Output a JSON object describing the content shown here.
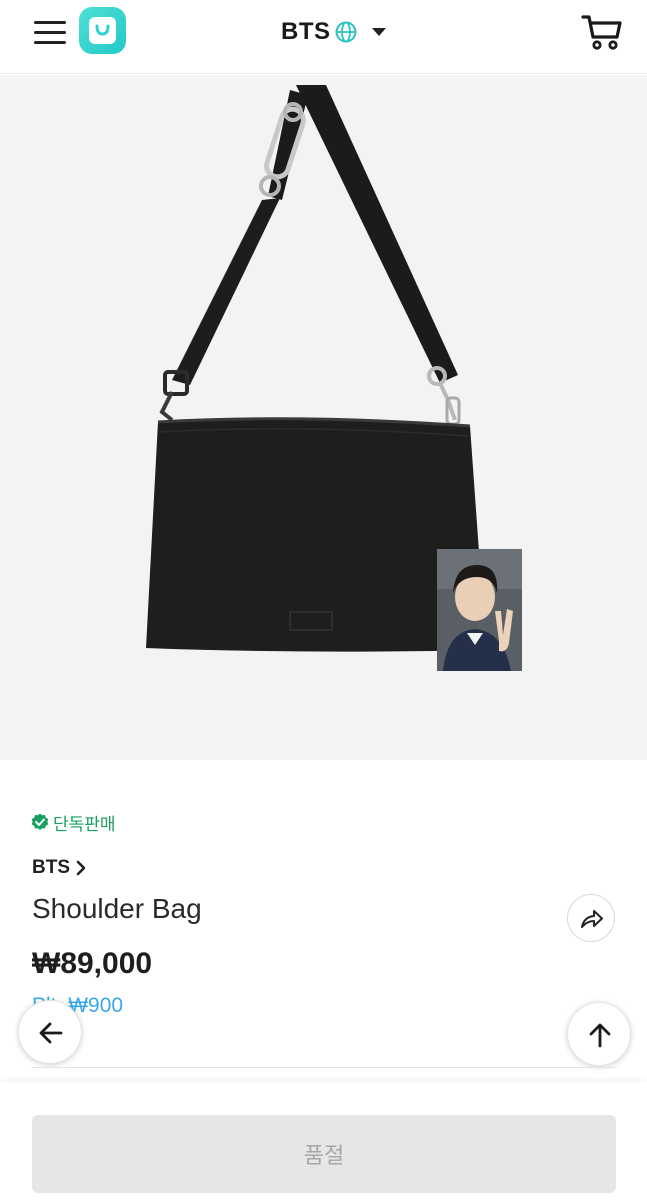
{
  "header": {
    "brand": "BTS",
    "icons": {
      "menu": "menu-icon",
      "logo": "app-logo-icon",
      "globe": "globe-icon",
      "caret": "caret-down-icon",
      "cart": "cart-icon"
    }
  },
  "product": {
    "exclusive_badge": "단독판매",
    "artist": "BTS",
    "name": "Shoulder Bag",
    "price": "₩89,000",
    "sub_price_faded": "Plt.",
    "sub_price": "₩900"
  },
  "actions": {
    "soldout_label": "품절"
  },
  "colors": {
    "accent_teal": "#2fd4cf",
    "badge_green": "#18a05e",
    "link_blue": "#3aa8e6",
    "disabled_gray": "#e6e6e6"
  }
}
